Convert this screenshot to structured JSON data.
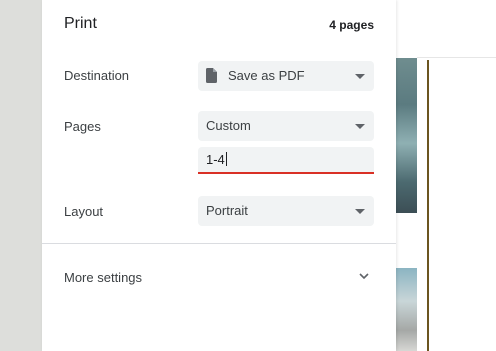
{
  "dialog": {
    "title": "Print",
    "page_count": "4 pages"
  },
  "destination": {
    "label": "Destination",
    "value": "Save as PDF",
    "icon": "document-icon"
  },
  "pages": {
    "label": "Pages",
    "value": "Custom",
    "range_value": "1-4"
  },
  "layout": {
    "label": "Layout",
    "value": "Portrait"
  },
  "more_settings": {
    "label": "More settings",
    "icon": "chevron-down-icon"
  },
  "colors": {
    "input_focus_underline": "#d93025",
    "select_background": "#f1f3f4"
  }
}
